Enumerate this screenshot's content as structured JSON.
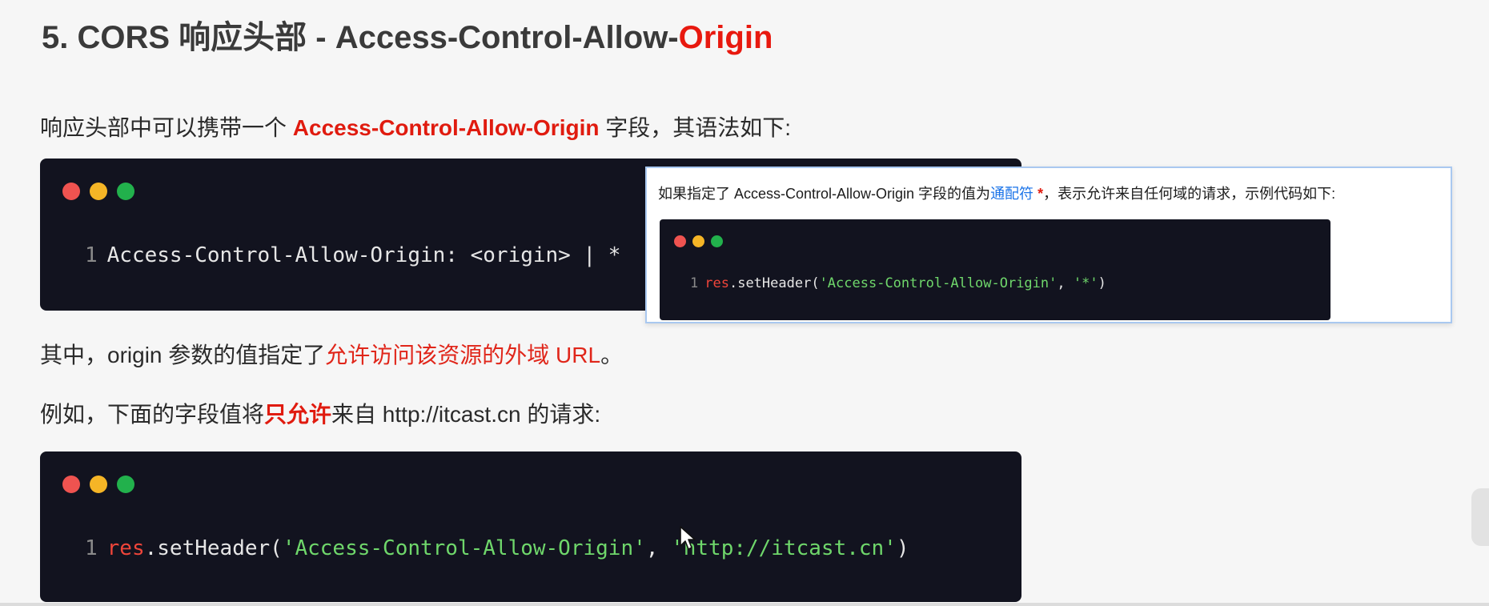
{
  "title": {
    "main": "5. CORS 响应头部 - Access-Control-Allow-",
    "highlight": "Origin"
  },
  "intro": {
    "before": "响应头部中可以携带一个 ",
    "highlight": "Access-Control-Allow-Origin",
    "after": " 字段，其语法如下:"
  },
  "code1": {
    "line_number": "1",
    "code": "Access-Control-Allow-Origin: <origin> | *"
  },
  "origin_note": {
    "before": "其中，origin 参数的值指定了",
    "highlight": "允许访问该资源的外域 URL",
    "after": "。"
  },
  "example_note": {
    "before": "例如，下面的字段值将",
    "highlight": "只允许",
    "after": "来自 http://itcast.cn 的请求:"
  },
  "code2": {
    "line_number": "1",
    "ident": "res",
    "call": ".setHeader(",
    "arg1": "'Access-Control-Allow-Origin'",
    "sep": ", ",
    "arg2": "'http://itcast.cn'",
    "close": ")"
  },
  "popup": {
    "before": "如果指定了 Access-Control-Allow-Origin 字段的值为",
    "link": "通配符",
    "star": " *",
    "after": "，表示允许来自任何域的请求，示例代码如下:",
    "code": {
      "line_number": "1",
      "ident": "res",
      "call": ".setHeader(",
      "arg1": "'Access-Control-Allow-Origin'",
      "sep": ", ",
      "arg2": "'*'",
      "close": ")"
    }
  },
  "colors": {
    "accent_red": "#e8190f",
    "code_bg": "#12131f",
    "string_green": "#6fd76b",
    "link_blue": "#1a73e8"
  },
  "icons": [
    "window-close-dot-icon",
    "window-minimize-dot-icon",
    "window-maximize-dot-icon",
    "mouse-cursor-icon"
  ]
}
